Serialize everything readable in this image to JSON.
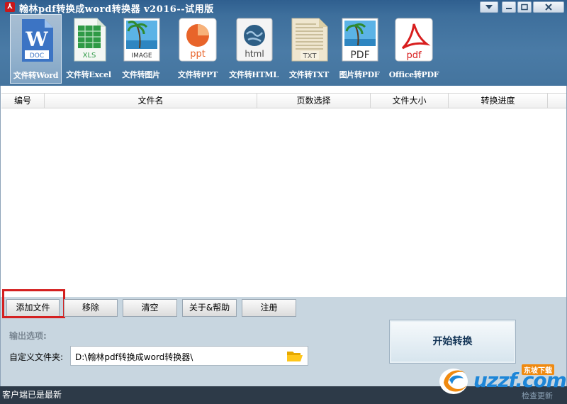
{
  "window": {
    "title": "翰林pdf转换成word转换器 v2016--试用版",
    "app_icon": "pdf-app-icon"
  },
  "tools": [
    {
      "label": "文件转Word",
      "icon": "word-doc-icon",
      "active": true
    },
    {
      "label": "文件转Excel",
      "icon": "excel-xls-icon",
      "active": false
    },
    {
      "label": "文件转图片",
      "icon": "image-icon",
      "active": false
    },
    {
      "label": "文件转PPT",
      "icon": "ppt-icon",
      "active": false
    },
    {
      "label": "文件转HTML",
      "icon": "html-icon",
      "active": false
    },
    {
      "label": "文件转TXT",
      "icon": "txt-icon",
      "active": false
    },
    {
      "label": "图片转PDF",
      "icon": "pdf-from-image-icon",
      "active": false
    },
    {
      "label": "Office转PDF",
      "icon": "acrobat-pdf-icon",
      "active": false
    }
  ],
  "table": {
    "columns": [
      "编号",
      "文件名",
      "页数选择",
      "文件大小",
      "转换进度"
    ],
    "rows": []
  },
  "buttons": {
    "add": "添加文件",
    "remove": "移除",
    "clear": "清空",
    "about": "关于&帮助",
    "register": "注册",
    "start": "开始转换"
  },
  "output": {
    "section_label": "输出选项:",
    "folder_label": "自定义文件夹:",
    "folder_path": "D:\\翰林pdf转换成word转换器\\"
  },
  "status": {
    "text": "客户端已是最新",
    "check_update": "检查更新"
  },
  "watermark": {
    "brand": "uzzf.com",
    "sub": "东坡下载"
  },
  "colors": {
    "title_bg": "#3e6f9c",
    "panel_bg": "#c8d6e0",
    "highlight": "#d42020",
    "status_bg": "#2d3a48"
  }
}
